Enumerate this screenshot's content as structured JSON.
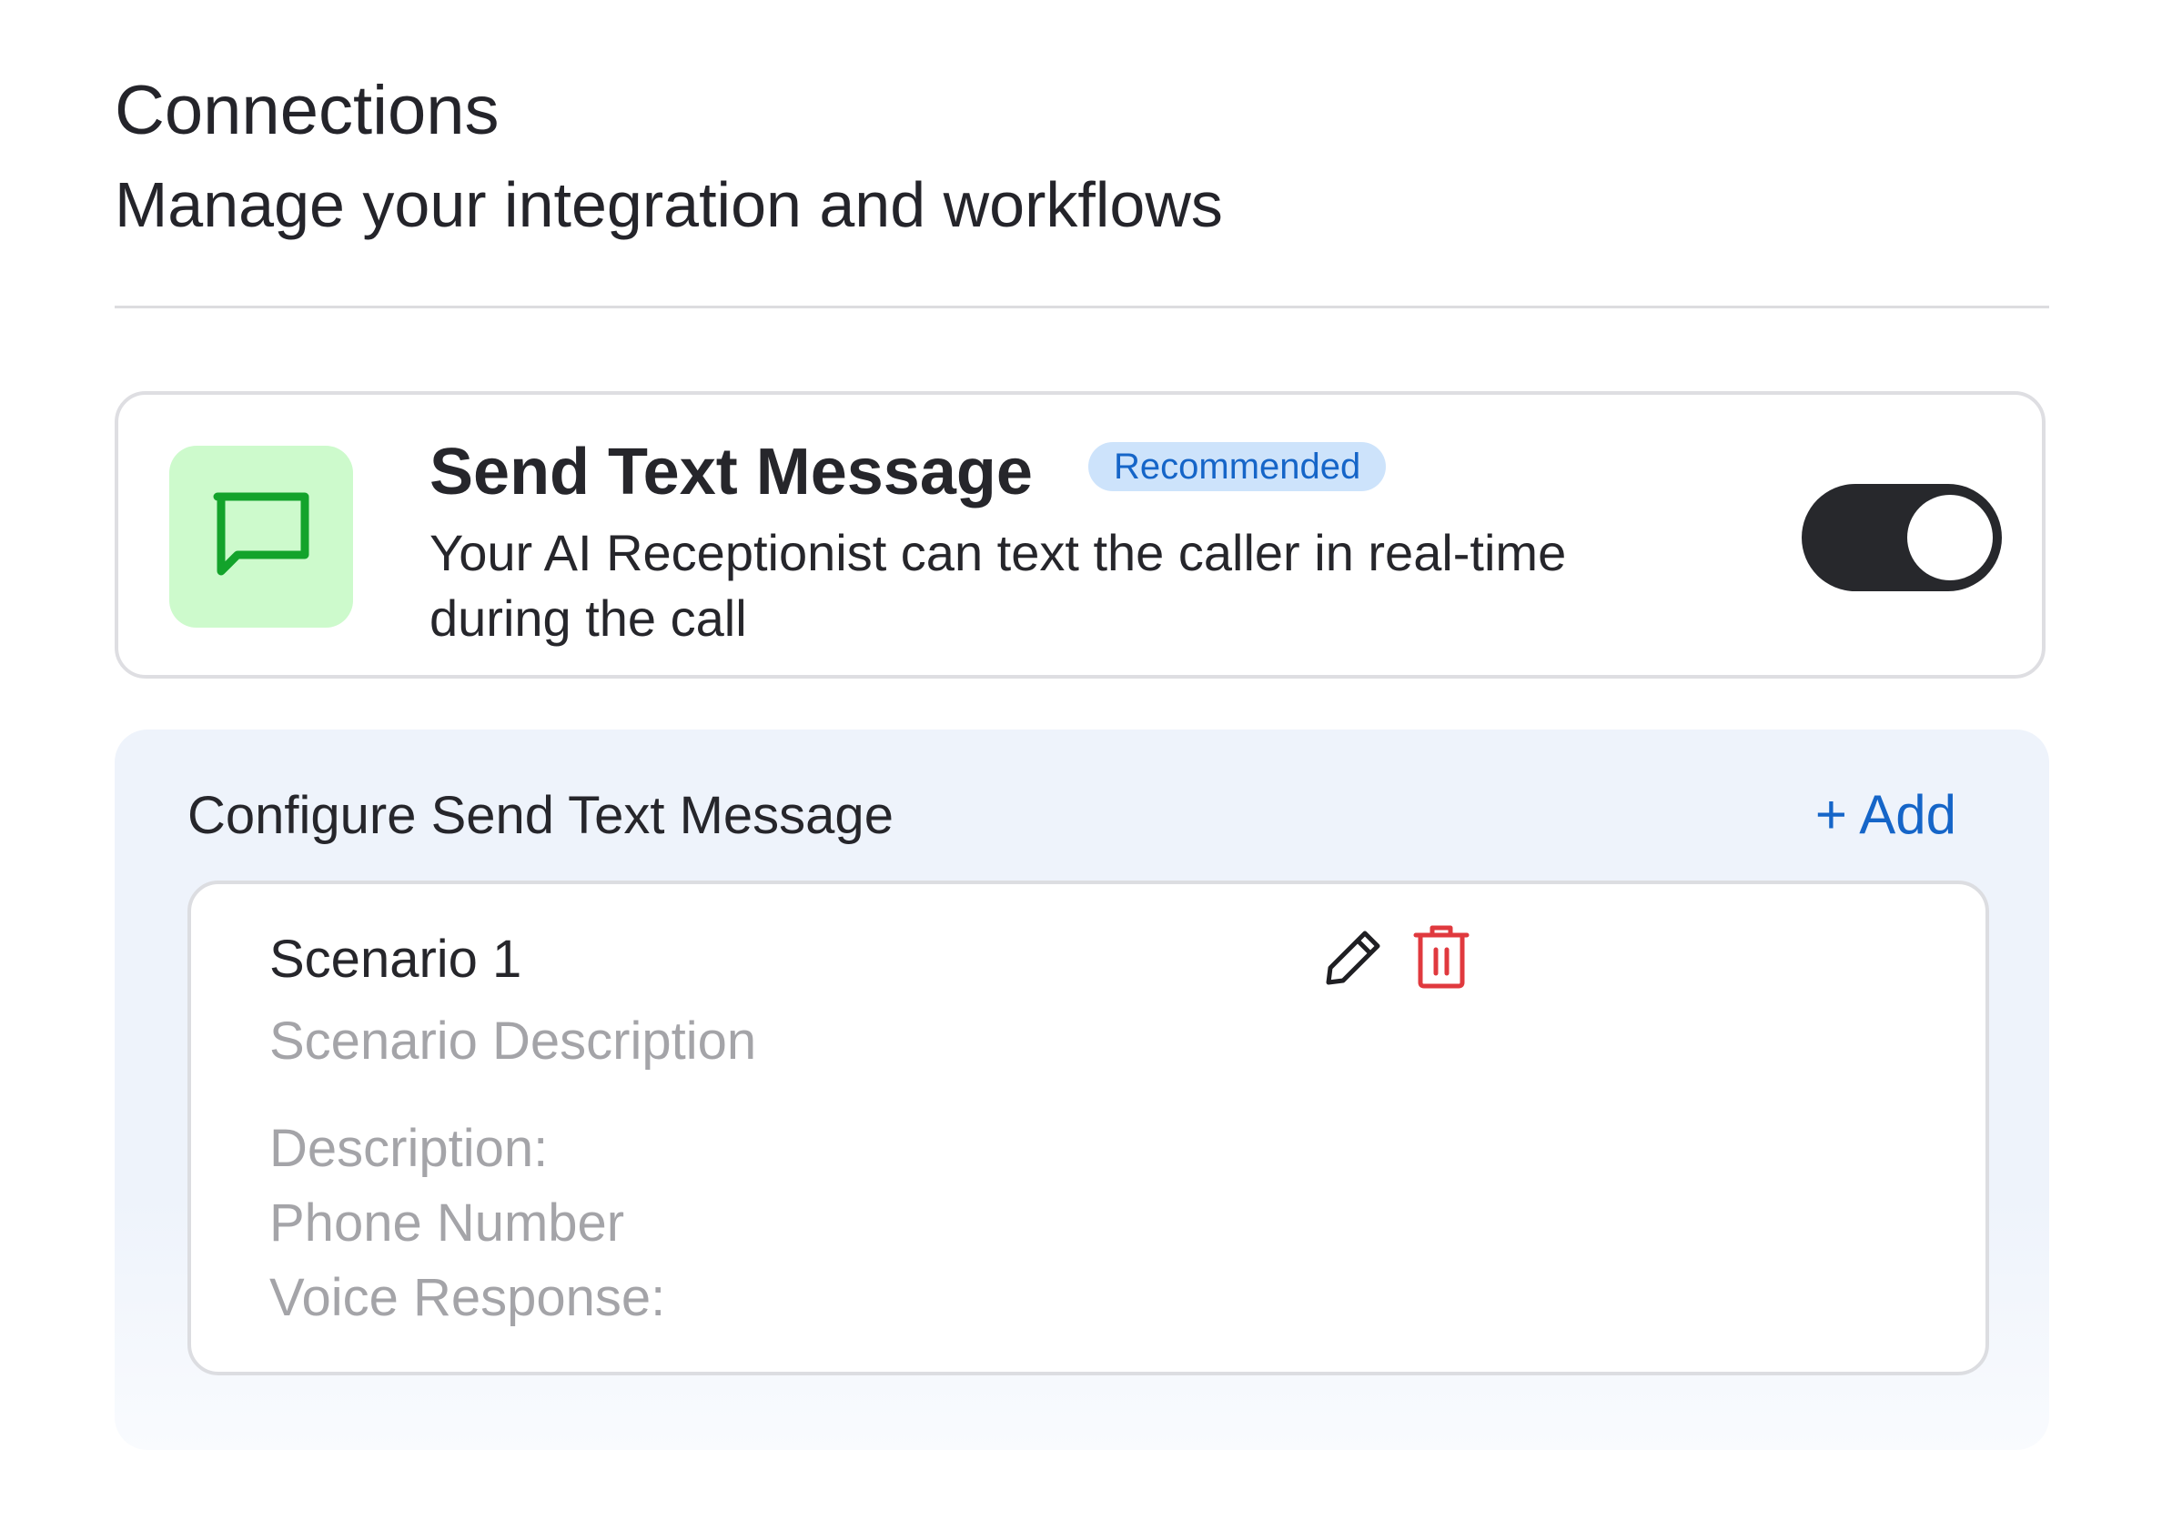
{
  "header": {
    "title": "Connections",
    "subtitle": "Manage your integration and workflows"
  },
  "connection": {
    "icon": "chat-bubble-icon",
    "title": "Send Text Message",
    "badge": "Recommended",
    "description": "Your AI Receptionist can text the caller in real-time during the call",
    "enabled": true
  },
  "configure": {
    "title": "Configure Send Text Message",
    "add_label": "+ Add",
    "scenarios": [
      {
        "name": "Scenario 1",
        "description": "Scenario Description",
        "fields": {
          "description_label": "Description:",
          "phone_label": "Phone Number",
          "voice_label": "Voice Response:"
        },
        "actions": {
          "edit_icon": "pencil-icon",
          "delete_icon": "trash-icon"
        }
      }
    ]
  },
  "colors": {
    "accent_blue": "#1565c8",
    "badge_bg": "#cde3fb",
    "icon_tile_bg": "#cdfacc",
    "icon_green": "#13a32b",
    "toggle_on": "#27282c",
    "delete_red": "#e0393e",
    "panel_bg": "#eef3fb",
    "muted_text": "#a4a4a8"
  }
}
